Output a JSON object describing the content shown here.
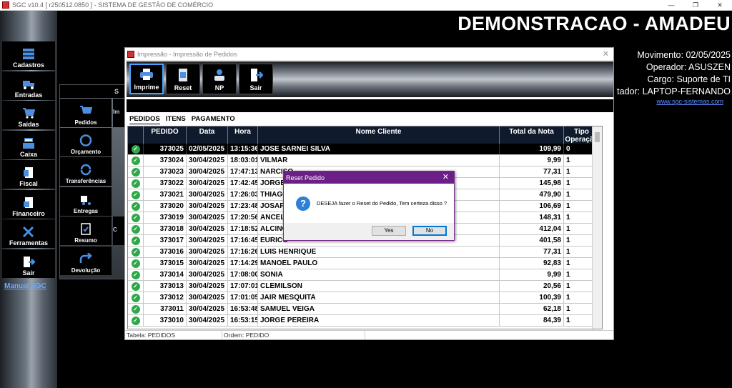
{
  "window": {
    "title": "SGC v10.4 [ r250512.0850 ] - SISTEMA DE GESTÃO DE COMÉRCIO",
    "minimize": "—",
    "maximize": "❐",
    "close": "✕"
  },
  "sidebar": {
    "items": [
      {
        "label": "Cadastros",
        "icon": "database-icon"
      },
      {
        "label": "Entradas",
        "icon": "truck-icon"
      },
      {
        "label": "Saídas",
        "icon": "cart-icon"
      },
      {
        "label": "Caixa",
        "icon": "register-icon"
      },
      {
        "label": "Fiscal",
        "icon": "document-icon"
      },
      {
        "label": "Financeiro",
        "icon": "finance-icon"
      },
      {
        "label": "Ferramentas",
        "icon": "tools-icon"
      },
      {
        "label": "Sair",
        "icon": "exit-icon"
      }
    ],
    "manual_link": "Manual SGC"
  },
  "submenu": {
    "items": [
      {
        "label": "Pedidos",
        "side": "Im"
      },
      {
        "label": "Orçamento",
        "side": ""
      },
      {
        "label": "Transferências",
        "side": ""
      },
      {
        "label": "Entregas",
        "side": ""
      },
      {
        "label": "Resumo",
        "side": "C"
      },
      {
        "label": "Devolução",
        "side": ""
      }
    ],
    "top_letter": "S"
  },
  "header": {
    "company": "DEMONSTRACAO - AMADEU",
    "movimento": "Movimento: 02/05/2025",
    "operador": "Operador: ASUSZEN",
    "cargo": "Cargo: Suporte de TI",
    "computador": "tador: LAPTOP-FERNANDO",
    "site": "www.sgc-sistemas.com"
  },
  "dialog": {
    "title": "Impressão - Impressão de Pedidos",
    "close": "✕",
    "toolbar": [
      {
        "label": "Imprime",
        "icon": "printer-icon"
      },
      {
        "label": "Reset",
        "icon": "reset-icon"
      },
      {
        "label": "NP",
        "icon": "np-icon"
      },
      {
        "label": "Sair",
        "icon": "exit-icon"
      }
    ],
    "tabs": [
      "PEDIDOS",
      "ITENS",
      "PAGAMENTO"
    ],
    "columns": [
      "PEDIDO",
      "Data",
      "Hora",
      "Nome Cliente",
      "Total da Nota",
      "Tipo Operação"
    ],
    "rows": [
      [
        "373025",
        "02/05/2025",
        "13:15:36",
        "JOSE SARNEI SILVA",
        "109,99",
        "0"
      ],
      [
        "373024",
        "30/04/2025",
        "18:03:01",
        "VILMAR",
        "9,99",
        "1"
      ],
      [
        "373023",
        "30/04/2025",
        "17:47:13",
        "NARCISO",
        "77,31",
        "1"
      ],
      [
        "373022",
        "30/04/2025",
        "17:42:45",
        "JORGE",
        "145,98",
        "1"
      ],
      [
        "373021",
        "30/04/2025",
        "17:26:03",
        "THIAGO",
        "479,90",
        "1"
      ],
      [
        "373020",
        "30/04/2025",
        "17:23:48",
        "JOSAFA",
        "106,69",
        "1"
      ],
      [
        "373019",
        "30/04/2025",
        "17:20:56",
        "ANCEL",
        "148,31",
        "1"
      ],
      [
        "373018",
        "30/04/2025",
        "17:18:52",
        "ALCINO",
        "412,04",
        "1"
      ],
      [
        "373017",
        "30/04/2025",
        "17:16:45",
        "EURICO",
        "401,58",
        "1"
      ],
      [
        "373016",
        "30/04/2025",
        "17:16:26",
        "LUIS HENRIQUE",
        "77,31",
        "1"
      ],
      [
        "373015",
        "30/04/2025",
        "17:14:29",
        "MANOEL PAULO",
        "92,83",
        "1"
      ],
      [
        "373014",
        "30/04/2025",
        "17:08:00",
        "SONIA",
        "9,99",
        "1"
      ],
      [
        "373013",
        "30/04/2025",
        "17:07:01",
        "CLEMILSON",
        "20,56",
        "1"
      ],
      [
        "373012",
        "30/04/2025",
        "17:01:05",
        "JAIR MESQUITA",
        "100,39",
        "1"
      ],
      [
        "373011",
        "30/04/2025",
        "16:53:48",
        "SAMUEL VEIGA",
        "62,18",
        "1"
      ],
      [
        "373010",
        "30/04/2025",
        "16:53:15",
        "JORGE PEREIRA",
        "84,39",
        "1"
      ]
    ],
    "status_table": "Tabela: PEDIDOS",
    "status_order": "Ordem: PEDIDO"
  },
  "modal": {
    "title": "Reset Pedido",
    "close": "✕",
    "icon": "question-icon",
    "message": "DESEJA fazer o Reset do Pedido, Tem certeza disso ?",
    "yes": "Yes",
    "no": "No"
  },
  "colors": {
    "modal_title": "#6c1f86",
    "grid_header": "#0f1b2d",
    "check": "#2ea84a"
  }
}
